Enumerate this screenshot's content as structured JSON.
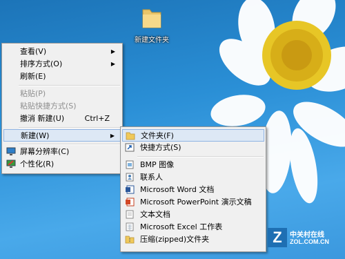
{
  "desktop": {
    "folder_label": "新建文件夹"
  },
  "context_menu": {
    "items": [
      {
        "label": "查看(V)"
      },
      {
        "label": "排序方式(O)"
      },
      {
        "label": "刷新(E)"
      },
      {
        "label": "粘贴(P)"
      },
      {
        "label": "粘贴快捷方式(S)"
      },
      {
        "label": "撤消 新建(U)",
        "shortcut": "Ctrl+Z"
      },
      {
        "label": "新建(W)"
      },
      {
        "label": "屏幕分辨率(C)"
      },
      {
        "label": "个性化(R)"
      }
    ]
  },
  "new_submenu": {
    "items": [
      {
        "label": "文件夹(F)"
      },
      {
        "label": "快捷方式(S)"
      },
      {
        "label": "BMP 图像"
      },
      {
        "label": "联系人"
      },
      {
        "label": "Microsoft Word 文档"
      },
      {
        "label": "Microsoft PowerPoint 演示文稿"
      },
      {
        "label": "文本文档"
      },
      {
        "label": "Microsoft Excel 工作表"
      },
      {
        "label": "压缩(zipped)文件夹"
      }
    ]
  },
  "watermark": {
    "cn": "中关村在线",
    "en": "ZOL.COM.CN",
    "letter": "Z"
  }
}
